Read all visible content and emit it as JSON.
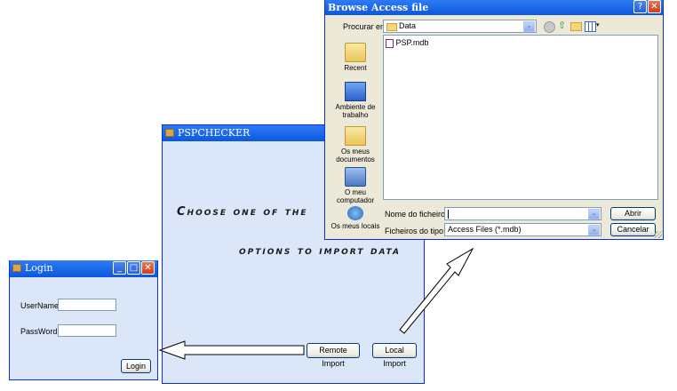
{
  "main_window": {
    "title": "PSPCHECKER",
    "instruction_line1": "Choose one of the",
    "instruction_line2": "options to import data",
    "remote_import_label": "Remote Import",
    "local_import_label": "Local Import"
  },
  "login_window": {
    "title": "Login",
    "username_label": "UserName:",
    "username_value": "",
    "password_label": "PassWord:",
    "password_value": "",
    "login_button": "Login",
    "minimize": "_",
    "maximize": "□",
    "close": "✕"
  },
  "browse_dialog": {
    "title": "Browse Access file",
    "help": "?",
    "close": "✕",
    "look_in_label": "Procurar em:",
    "look_in_value": "Data",
    "places": [
      "Recent",
      "Ambiente de trabalho",
      "Os meus documentos",
      "O meu computador",
      "Os meus locais"
    ],
    "files": [
      "PSP.mdb"
    ],
    "filename_label": "Nome do ficheiro:",
    "filename_value": "",
    "filetype_label": "Ficheiros do tipo:",
    "filetype_value": "Access Files (*.mdb)",
    "open_button": "Abrir",
    "cancel_button": "Cancelar"
  },
  "colors": {
    "titlebar": "#0a58de",
    "form_background": "#dbe7f9",
    "dialog_background": "#ece9d8"
  }
}
